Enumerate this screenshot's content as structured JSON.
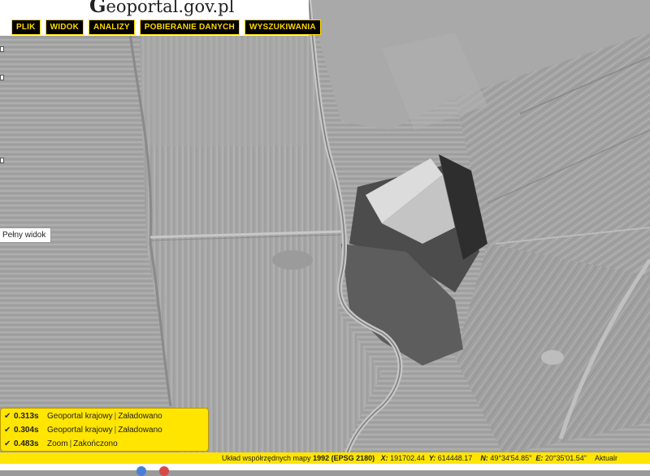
{
  "header": {
    "logo": {
      "initial": "G",
      "text": "eoportal.gov.pl"
    },
    "menu": [
      "PLIK",
      "WIDOK",
      "ANALIZY",
      "POBIERANIE DANYCH",
      "WYSZUKIWANIA"
    ]
  },
  "tooltip": {
    "text": "Pełny widok"
  },
  "log": [
    {
      "time": "0.313s",
      "source": "Geoportal krajowy",
      "status": "Załadowano"
    },
    {
      "time": "0.304s",
      "source": "Geoportal krajowy",
      "status": "Załadowano"
    },
    {
      "time": "0.483s",
      "source": "Zoom",
      "status": "Zakończono"
    }
  ],
  "statusbar": {
    "label": "Układ współrzędnych mapy",
    "crs": "1992 (EPSG 2180)",
    "x_label": "X:",
    "x_value": "191702.44",
    "y_label": "Y:",
    "y_value": "614448.17",
    "n_label": "N:",
    "n_value": "49°34'54.85\"",
    "e_label": "E:",
    "e_value": "20°35'01.54\"",
    "extra": "Aktualr"
  },
  "colors": {
    "accent": "#ffe500",
    "menu_bg": "#000000",
    "menu_text": "#ffd800"
  }
}
